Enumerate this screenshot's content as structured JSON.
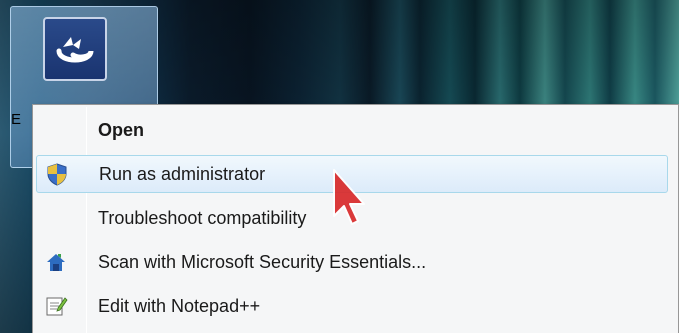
{
  "desktop": {
    "icon_caption": "E",
    "icon_name": "app-shortcut-icon",
    "accent": "#1a3470"
  },
  "context_menu": {
    "items": [
      {
        "label": "Open",
        "icon": "",
        "bold": true,
        "hover": false
      },
      {
        "label": "Run as administrator",
        "icon": "uac-shield-icon",
        "bold": false,
        "hover": true
      },
      {
        "label": "Troubleshoot compatibility",
        "icon": "",
        "bold": false,
        "hover": false
      },
      {
        "label": "Scan with Microsoft Security Essentials...",
        "icon": "security-essentials-icon",
        "bold": false,
        "hover": false
      },
      {
        "label": "Edit with Notepad++",
        "icon": "notepad-plus-plus-icon",
        "bold": false,
        "hover": false
      }
    ],
    "hover_color": "#dcebfa"
  }
}
